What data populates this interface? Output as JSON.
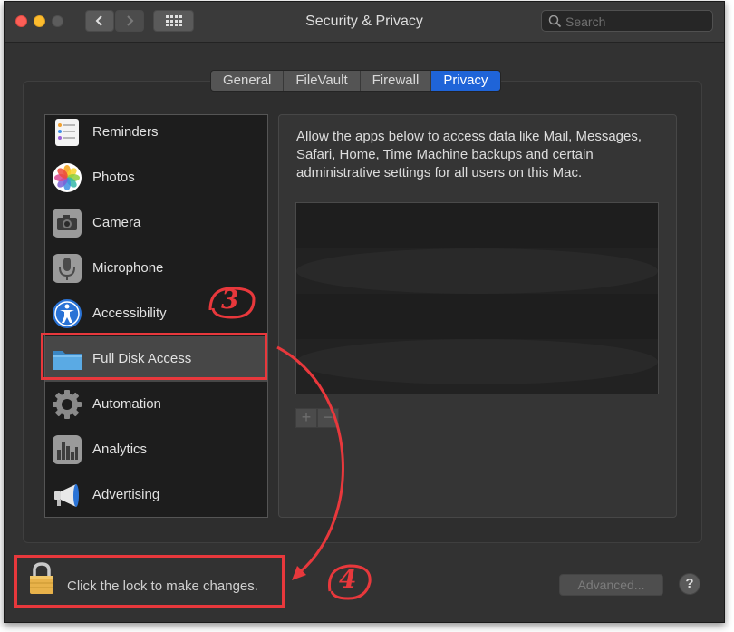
{
  "window": {
    "title": "Security & Privacy"
  },
  "search": {
    "placeholder": "Search"
  },
  "tabs": [
    {
      "label": "General",
      "active": false
    },
    {
      "label": "FileVault",
      "active": false
    },
    {
      "label": "Firewall",
      "active": false
    },
    {
      "label": "Privacy",
      "active": true
    }
  ],
  "sidebar": {
    "items": [
      {
        "label": "Reminders",
        "icon": "reminders-icon",
        "selected": false
      },
      {
        "label": "Photos",
        "icon": "photos-icon",
        "selected": false
      },
      {
        "label": "Camera",
        "icon": "camera-icon",
        "selected": false
      },
      {
        "label": "Microphone",
        "icon": "microphone-icon",
        "selected": false
      },
      {
        "label": "Accessibility",
        "icon": "accessibility-icon",
        "selected": false
      },
      {
        "label": "Full Disk Access",
        "icon": "folder-icon",
        "selected": true
      },
      {
        "label": "Automation",
        "icon": "gear-icon",
        "selected": false
      },
      {
        "label": "Analytics",
        "icon": "analytics-icon",
        "selected": false
      },
      {
        "label": "Advertising",
        "icon": "megaphone-icon",
        "selected": false
      }
    ]
  },
  "main": {
    "description": "Allow the apps below to access data like Mail, Messages, Safari, Home, Time Machine backups and certain administrative settings for all users on this Mac.",
    "add_label": "+",
    "remove_label": "−"
  },
  "footer": {
    "lock_text": "Click the lock to make changes.",
    "advanced_label": "Advanced...",
    "help_label": "?"
  },
  "annotations": {
    "step3": "3",
    "step4": "4",
    "color": "#e8383c"
  },
  "colors": {
    "accent": "#1f64d8",
    "window_bg": "#323232",
    "list_bg": "#1d1d1d"
  }
}
